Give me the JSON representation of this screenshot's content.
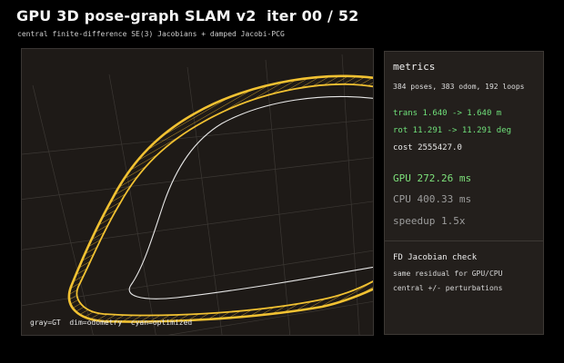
{
  "header": {
    "title": "GPU 3D pose-graph SLAM v2  iter 00 / 52",
    "subtitle": "central finite-difference SE(3) Jacobians + damped Jacobi-PCG"
  },
  "viewport": {
    "legend": "gray=GT  dim=odometry  cyan=optimized"
  },
  "metrics": {
    "title": "metrics",
    "poses": "384 poses, 383 odom, 192 loops",
    "trans": "trans 1.640 -> 1.640 m",
    "rot": "rot 11.291 -> 11.291 deg",
    "cost": "cost 2555427.0",
    "gpu": "GPU 272.26 ms",
    "cpu": "CPU 400.33 ms",
    "speedup": "speedup 1.5x"
  },
  "fd_check": {
    "title": "FD Jacobian check",
    "line1": "same residual for GPU/CPU",
    "line2": "central +/- perturbations"
  },
  "colors": {
    "accent_green": "#6fe07a",
    "trajectory_yellow": "#f2c232",
    "ground_truth": "#e8e8e8",
    "panel_bg": "#231f1c",
    "viewport_bg": "#1e1a17"
  }
}
